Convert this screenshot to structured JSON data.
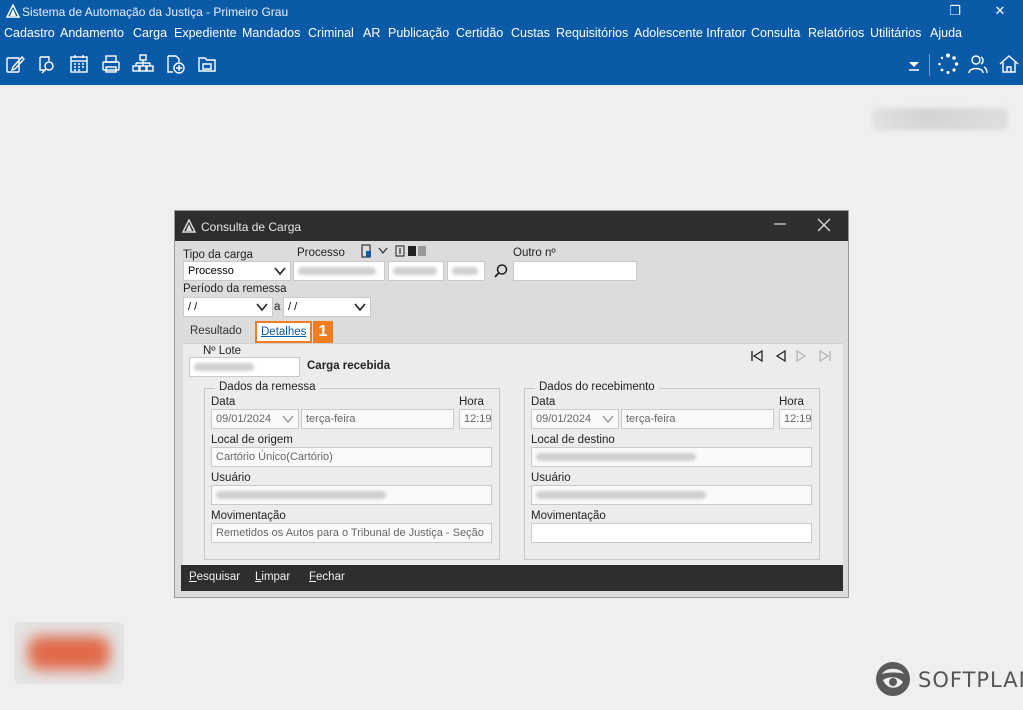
{
  "app": {
    "title": "Sistema de Automação da Justiça - Primeiro Grau",
    "brand_color": "#0b5aa8",
    "accent_color": "#f07d1e",
    "window_controls": {
      "restore": "❐",
      "close": "✕"
    }
  },
  "menu": {
    "items": [
      "Cadastro",
      "Andamento",
      "Carga",
      "Expediente",
      "Mandados",
      "Criminal",
      "AR",
      "Publicação",
      "Certidão",
      "Custas",
      "Requisitórios",
      "Adolescente Infrator",
      "Consulta",
      "Relatórios",
      "Utilitários",
      "Ajuda"
    ]
  },
  "toolbar": {
    "icons": [
      "edit-icon",
      "search-process-icon",
      "calendar-icon",
      "printer-icon",
      "org-chart-icon",
      "add-document-icon",
      "folder-icon",
      "dropdown-arrow-icon",
      "loading-spinner-icon",
      "users-icon",
      "home-icon"
    ]
  },
  "footer_brand": {
    "name": "SOFTPLAN"
  },
  "dialog": {
    "title": "Consulta de Carga",
    "form": {
      "tipo_label": "Tipo da carga",
      "tipo_value": "Processo",
      "processo_label": "Processo",
      "outro_label": "Outro nº",
      "periodo_label": "Período da remessa",
      "date_from": "/ /",
      "date_sep": "a",
      "date_to": "/ /"
    },
    "tabs": {
      "resultado": "Resultado",
      "detalhes": "Detalhes",
      "step": "1"
    },
    "details": {
      "lote_label": "Nº Lote",
      "status_text": "Carga recebida",
      "remessa": {
        "title": "Dados da remessa",
        "data_label": "Data",
        "hora_label": "Hora",
        "date": "09/01/2024",
        "weekday": "terça-feira",
        "time": "12:19",
        "local_label": "Local de origem",
        "local_value": "Cartório Único(Cartório)",
        "usuario_label": "Usuário",
        "mov_label": "Movimentação",
        "mov_value": "Remetidos os Autos para o Tribunal de Justiça - Seção"
      },
      "recebimento": {
        "title": "Dados do recebimento",
        "data_label": "Data",
        "hora_label": "Hora",
        "date": "09/01/2024",
        "weekday": "terça-feira",
        "time": "12:19",
        "local_label": "Local de destino",
        "usuario_label": "Usuário",
        "mov_label": "Movimentação",
        "mov_value": ""
      }
    },
    "actions": {
      "pesquisar_first": "P",
      "pesquisar_rest": "esquisar",
      "limpar_first": "L",
      "limpar_rest": "impar",
      "fechar_first": "F",
      "fechar_rest": "echar"
    }
  }
}
